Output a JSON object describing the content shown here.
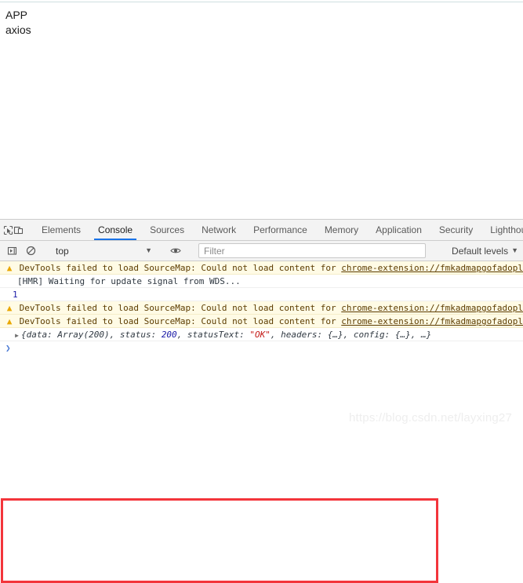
{
  "page": {
    "app_title": "APP",
    "app_subtitle": "axios"
  },
  "devtools": {
    "toolbar_icons": {
      "inspect": "inspect-element-icon",
      "device": "device-toolbar-icon"
    },
    "tabs": [
      {
        "label": "Elements",
        "active": false
      },
      {
        "label": "Console",
        "active": true
      },
      {
        "label": "Sources",
        "active": false
      },
      {
        "label": "Network",
        "active": false
      },
      {
        "label": "Performance",
        "active": false
      },
      {
        "label": "Memory",
        "active": false
      },
      {
        "label": "Application",
        "active": false
      },
      {
        "label": "Security",
        "active": false
      },
      {
        "label": "Lighthouse",
        "active": false
      }
    ],
    "console_toolbar": {
      "execute_label": "execute-icon",
      "clear_label": "clear-console-icon",
      "context_value": "top",
      "context_caret": "▼",
      "eye_icon": "eye-icon",
      "filter_placeholder": "Filter",
      "filter_value": "",
      "levels_label": "Default levels",
      "levels_caret": "▼"
    },
    "messages": [
      {
        "type": "warning",
        "icon": "warning-triangle-icon",
        "text": "DevTools failed to load SourceMap: Could not load content for ",
        "url": "chrome-extension://fmkadmapgofadopljbjfkapdkoie"
      },
      {
        "type": "log",
        "icon": "",
        "text": "[HMR] Waiting for update signal from WDS...",
        "url": ""
      },
      {
        "type": "number",
        "icon": "",
        "text": "1",
        "url": ""
      },
      {
        "type": "warning",
        "icon": "warning-triangle-icon",
        "text": "DevTools failed to load SourceMap: Could not load content for ",
        "url": "chrome-extension://fmkadmapgofadopljbjfkapdkoie"
      },
      {
        "type": "warning",
        "icon": "warning-triangle-icon",
        "text": "DevTools failed to load SourceMap: Could not load content for ",
        "url": "chrome-extension://fmkadmapgofadopljbjfkapdkoie"
      }
    ],
    "object_preview": {
      "disclosure": "▶",
      "open_brace": "{data: Array(200), status: ",
      "status_value": "200",
      "middle": ", statusText: ",
      "status_text": "\"OK\"",
      "tail": ", headers: {…}, config: {…}, …}"
    },
    "prompt": {
      "chevron": "❯",
      "value": ""
    }
  },
  "annotation": {
    "box_color": "#f3353b"
  },
  "watermark": {
    "text": "https://blog.csdn.net/layxing27"
  }
}
